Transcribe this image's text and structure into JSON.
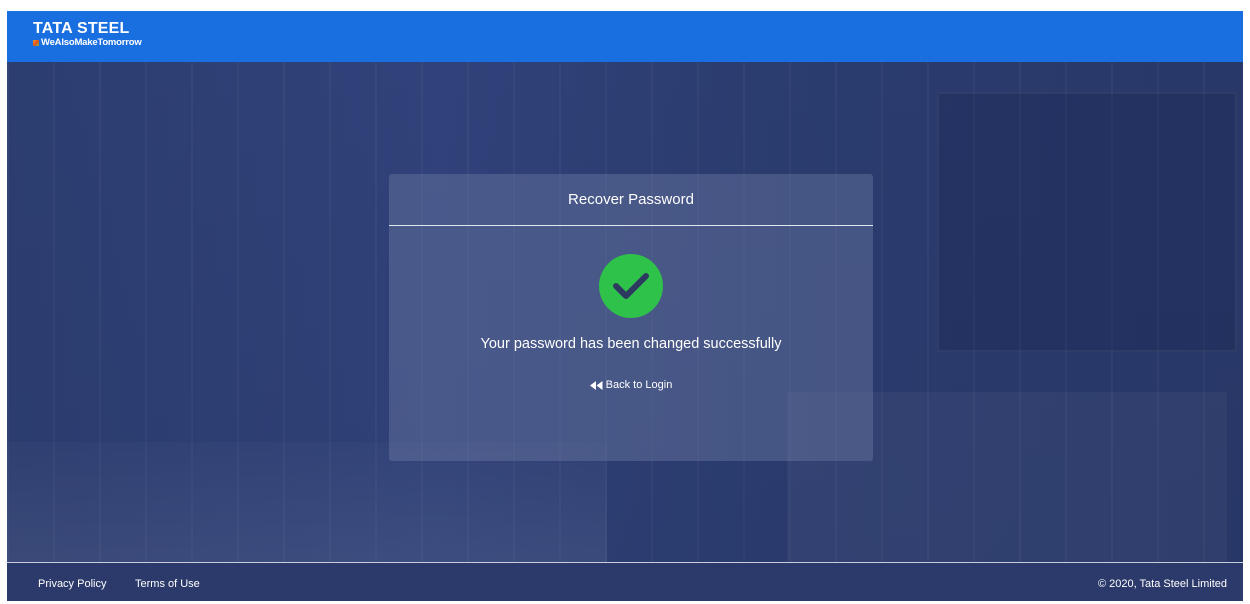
{
  "header": {
    "logo_main": "TATA STEEL",
    "logo_tagline": "WeAlsoMakeTomorrow",
    "brand_color": "#1a6fe0"
  },
  "card": {
    "title": "Recover Password",
    "status_icon": "check-circle-icon",
    "status_color": "#2fc24a",
    "message": "Your password has been changed successfully",
    "back_link_icon": "double-chevron-left-icon",
    "back_link_label": "Back to Login"
  },
  "footer": {
    "privacy_label": "Privacy Policy",
    "terms_label": "Terms of Use",
    "copyright": "© 2020, Tata Steel Limited"
  }
}
